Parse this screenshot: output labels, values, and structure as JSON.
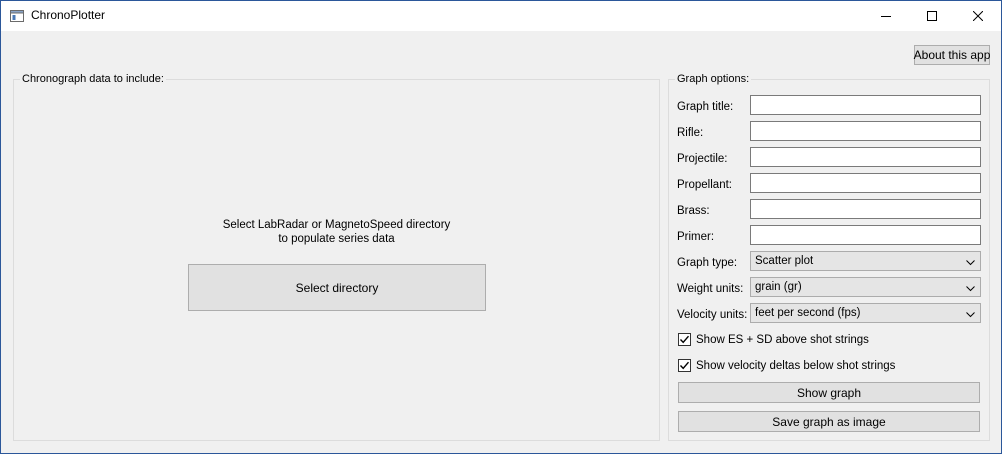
{
  "window": {
    "title": "ChronoPlotter",
    "icon": "app-window-icon",
    "controls": [
      "minimize-icon",
      "maximize-icon",
      "close-icon"
    ]
  },
  "about_button_label": "About this app",
  "data_panel": {
    "title": "Chronograph data to include:",
    "message_line1": "Select LabRadar or MagnetoSpeed directory",
    "message_line2": "to populate series data",
    "select_button_label": "Select directory"
  },
  "options_panel": {
    "title": "Graph options:",
    "fields": {
      "graph_title": {
        "label": "Graph title:",
        "value": ""
      },
      "rifle": {
        "label": "Rifle:",
        "value": ""
      },
      "projectile": {
        "label": "Projectile:",
        "value": ""
      },
      "propellant": {
        "label": "Propellant:",
        "value": ""
      },
      "brass": {
        "label": "Brass:",
        "value": ""
      },
      "primer": {
        "label": "Primer:",
        "value": ""
      }
    },
    "graph_type": {
      "label": "Graph type:",
      "selected": "Scatter plot"
    },
    "weight_units": {
      "label": "Weight units:",
      "selected": "grain (gr)"
    },
    "velocity_units": {
      "label": "Velocity units:",
      "selected": "feet per second (fps)"
    },
    "show_es_sd": {
      "label": "Show ES + SD above shot strings",
      "checked": true
    },
    "show_deltas": {
      "label": "Show velocity deltas below shot strings",
      "checked": true
    },
    "show_graph_label": "Show graph",
    "save_graph_label": "Save graph as image"
  }
}
